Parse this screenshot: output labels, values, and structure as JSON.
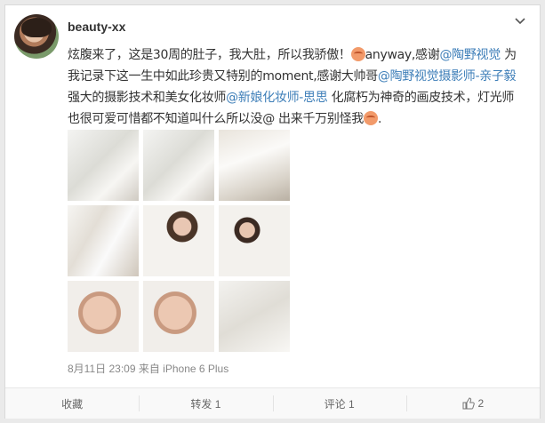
{
  "post": {
    "username": "beauty-xx",
    "text_lines": [
      [
        {
          "t": "text",
          "v": "炫腹来了，这是30周的肚子，我大肚，所以我骄傲！"
        },
        {
          "t": "emoji"
        },
        {
          "t": "text",
          "v": "anyway,感谢"
        },
        {
          "t": "link",
          "v": "@陶野视觉"
        },
        {
          "t": "text",
          "v": " 为"
        }
      ],
      [
        {
          "t": "text",
          "v": "我记录下这一生中如此珍贵又特别的moment,感谢大帅哥"
        },
        {
          "t": "link",
          "v": "@陶野视觉摄影师-亲子毅"
        }
      ],
      [
        {
          "t": "text",
          "v": "强大的摄影技术和美女化妆师"
        },
        {
          "t": "link",
          "v": "@新娘化妆师-思思"
        },
        {
          "t": "text",
          "v": " 化腐朽为神奇的画皮技术，灯光师"
        }
      ],
      [
        {
          "t": "text",
          "v": "也很可爱可惜都不知道叫什么所以没@ 出来千万别怪我"
        },
        {
          "t": "emoji"
        },
        {
          "t": "text",
          "v": "."
        }
      ]
    ],
    "timestamp": "8月11日 23:09",
    "source": "来自 iPhone 6 Plus",
    "photos": [
      {
        "name": "photo-1",
        "tone": "veil-white"
      },
      {
        "name": "photo-2",
        "tone": "veil-white"
      },
      {
        "name": "photo-3",
        "tone": "room-light"
      },
      {
        "name": "photo-4",
        "tone": "sofa-white"
      },
      {
        "name": "photo-5",
        "tone": "portrait-white"
      },
      {
        "name": "photo-6",
        "tone": "portrait-lace"
      },
      {
        "name": "photo-7",
        "tone": "face-closeup"
      },
      {
        "name": "photo-8",
        "tone": "face-closeup"
      },
      {
        "name": "photo-9",
        "tone": "lace-white"
      }
    ]
  },
  "actions": {
    "favorite": "收藏",
    "repost": "转发 1",
    "comment": "评论 1",
    "like": "2"
  },
  "colors": {
    "link": "#3d7eb8",
    "text": "#333333",
    "meta": "#888888"
  },
  "icons": {
    "menu": "chevron-down-icon",
    "like": "thumbs-up-icon",
    "emoji": "doge-emoji-icon"
  }
}
